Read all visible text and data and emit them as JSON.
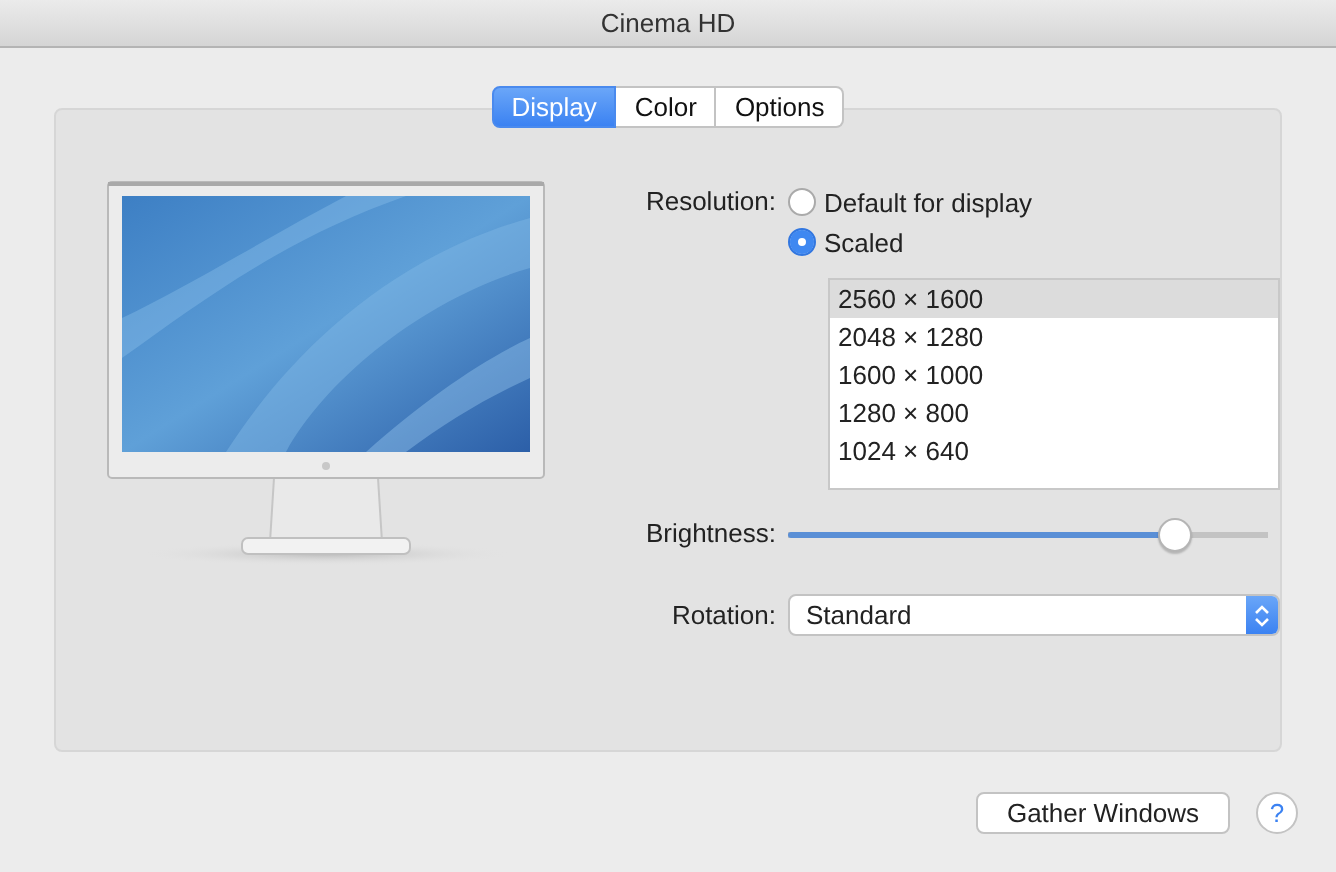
{
  "window": {
    "title": "Cinema HD"
  },
  "tabs": [
    {
      "label": "Display",
      "selected": true
    },
    {
      "label": "Color",
      "selected": false
    },
    {
      "label": "Options",
      "selected": false
    }
  ],
  "resolution": {
    "label": "Resolution:",
    "options": [
      {
        "label": "Default for display",
        "selected": false
      },
      {
        "label": "Scaled",
        "selected": true
      }
    ],
    "list": [
      {
        "label": "2560 × 1600",
        "selected": true
      },
      {
        "label": "2048 × 1280",
        "selected": false
      },
      {
        "label": "1600 × 1000",
        "selected": false
      },
      {
        "label": "1280 × 800",
        "selected": false
      },
      {
        "label": "1024 × 640",
        "selected": false
      }
    ]
  },
  "brightness": {
    "label": "Brightness:",
    "level": 0.81
  },
  "rotation": {
    "label": "Rotation:",
    "value": "Standard"
  },
  "buttons": [
    {
      "kind": "text",
      "label": "Gather Windows"
    },
    {
      "kind": "help",
      "label": "?"
    }
  ]
}
